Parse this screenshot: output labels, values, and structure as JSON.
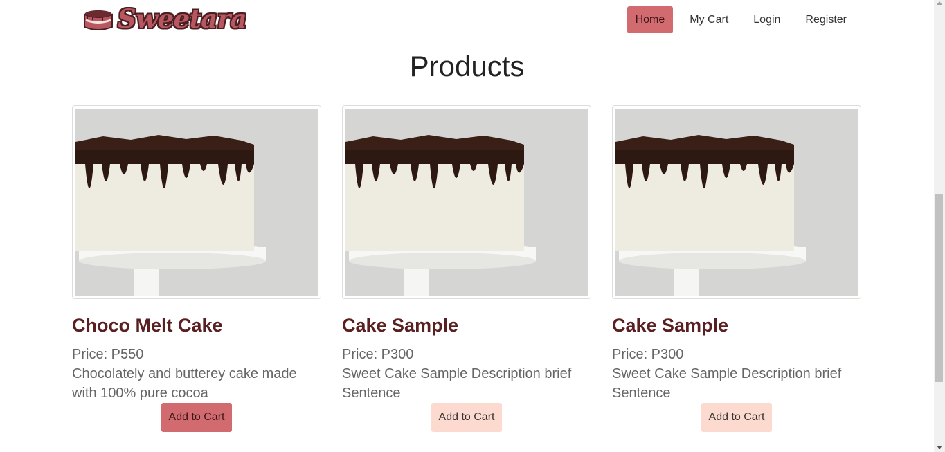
{
  "brand": {
    "name": "Sweetara",
    "logo_icon": "cake-slice-icon"
  },
  "nav": {
    "items": [
      {
        "label": "Home",
        "active": true
      },
      {
        "label": "My Cart",
        "active": false
      },
      {
        "label": "Login",
        "active": false
      },
      {
        "label": "Register",
        "active": false
      }
    ]
  },
  "page_title": "Products",
  "products": [
    {
      "name": "Choco Melt Cake",
      "price": "Price: P550",
      "description": "Chocolately and butterey cake made with 100% pure cocoa",
      "button": "Add to Cart",
      "image": "chocolate-drip-cake-image"
    },
    {
      "name": "Cake Sample",
      "price": "Price: P300",
      "description": "Sweet Cake Sample Description brief Sentence",
      "button": "Add to Cart",
      "image": "chocolate-drip-cake-image"
    },
    {
      "name": "Cake Sample",
      "price": "Price: P300",
      "description": "Sweet Cake Sample Description brief Sentence",
      "button": "Add to Cart",
      "image": "chocolate-drip-cake-image"
    }
  ],
  "colors": {
    "accent": "#d16b6f",
    "accent_light": "#fcdad0",
    "title": "#5a1f20",
    "brand_text": "#b8575f"
  }
}
